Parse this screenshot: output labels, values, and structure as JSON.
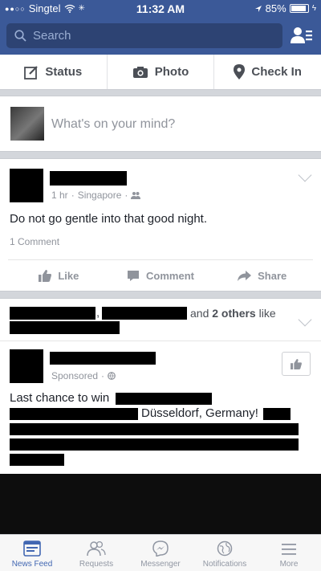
{
  "status_bar": {
    "carrier": "Singtel",
    "time": "11:32 AM",
    "battery": "85%"
  },
  "search": {
    "placeholder": "Search"
  },
  "composer_actions": [
    {
      "label": "Status",
      "icon": "edit-icon"
    },
    {
      "label": "Photo",
      "icon": "camera-icon"
    },
    {
      "label": "Check In",
      "icon": "location-pin-icon"
    }
  ],
  "composer": {
    "prompt": "What's on your mind?"
  },
  "post1": {
    "time": "1 hr",
    "location": "Singapore",
    "text": "Do not go gentle into that good night.",
    "comments": "1 Comment"
  },
  "reactions": {
    "like": "Like",
    "comment": "Comment",
    "share": "Share"
  },
  "social": {
    "joiner": ",",
    "and_text": "and",
    "others": "2 others",
    "like_text": "like"
  },
  "post2": {
    "sponsored": "Sponsored",
    "text_start": "Last chance to win",
    "text_mid": "Düsseldorf, Germany!"
  },
  "tabs": [
    {
      "label": "News Feed",
      "icon": "news-feed-icon",
      "active": true
    },
    {
      "label": "Requests",
      "icon": "friends-icon"
    },
    {
      "label": "Messenger",
      "icon": "messenger-icon"
    },
    {
      "label": "Notifications",
      "icon": "globe-icon"
    },
    {
      "label": "More",
      "icon": "menu-icon"
    }
  ],
  "colors": {
    "brand": "#3b5998",
    "active_tab": "#4267b2"
  }
}
